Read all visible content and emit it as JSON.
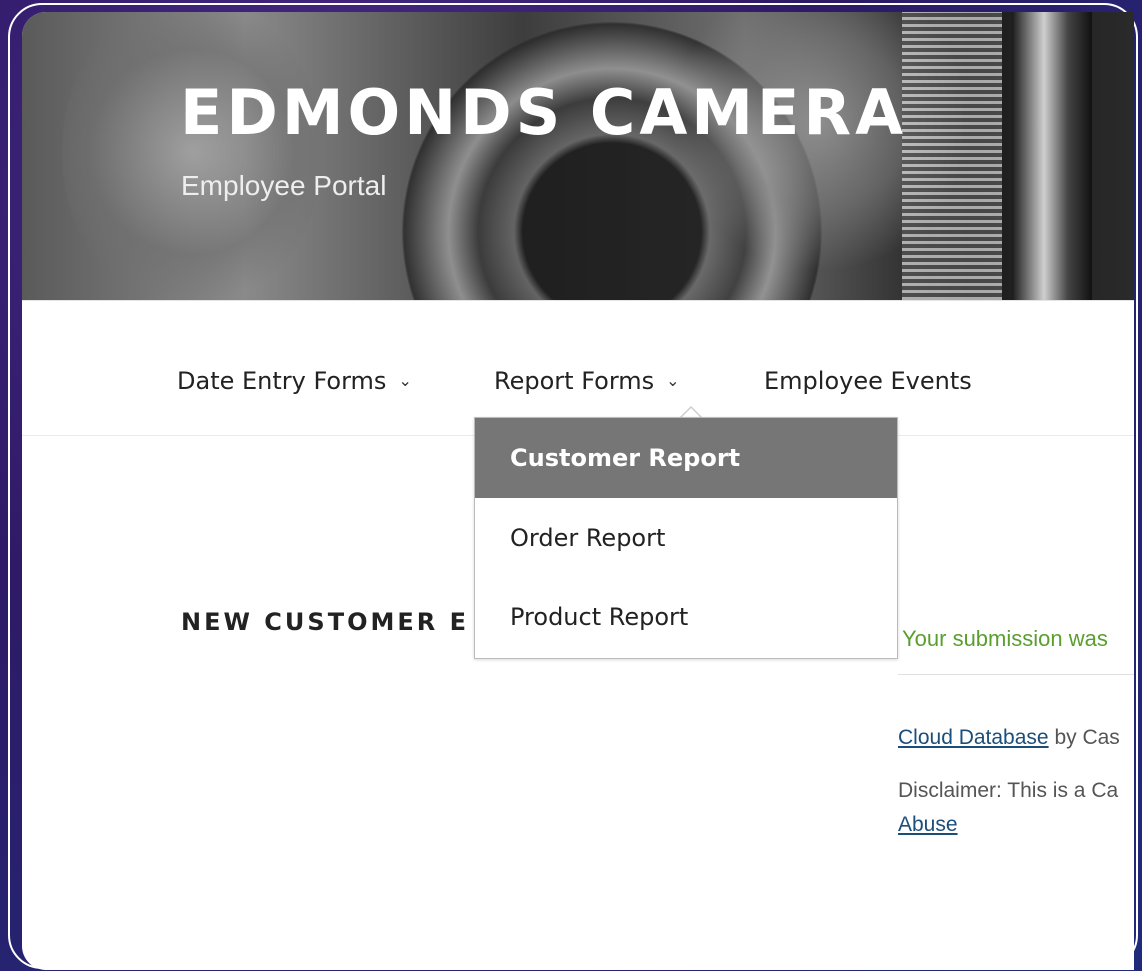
{
  "header": {
    "site_title": "EDMONDS CAMERA",
    "site_description": "Employee Portal"
  },
  "nav": {
    "items": [
      {
        "label": "Date Entry Forms",
        "has_dropdown": true
      },
      {
        "label": "Report Forms",
        "has_dropdown": true,
        "expanded": true
      },
      {
        "label": "Employee Events",
        "has_dropdown": false
      }
    ],
    "chevron_icon": "chevron-down-icon"
  },
  "submenu": {
    "items": [
      {
        "label": "Customer Report",
        "active": true
      },
      {
        "label": "Order Report",
        "active": false
      },
      {
        "label": "Product Report",
        "active": false
      }
    ]
  },
  "page": {
    "entry_title_visible": "NEW CUSTOMER E",
    "success_message": "Your submission was",
    "footer_link": "Cloud Database",
    "footer_by": " by Cas",
    "disclaimer": "Disclaimer: This is a Ca",
    "abuse_link": "Abuse"
  },
  "colors": {
    "active_menu_bg": "#767676",
    "success_text": "#5a9e2f",
    "link": "#1b4e7a",
    "outer_background": "#2e1a66"
  }
}
